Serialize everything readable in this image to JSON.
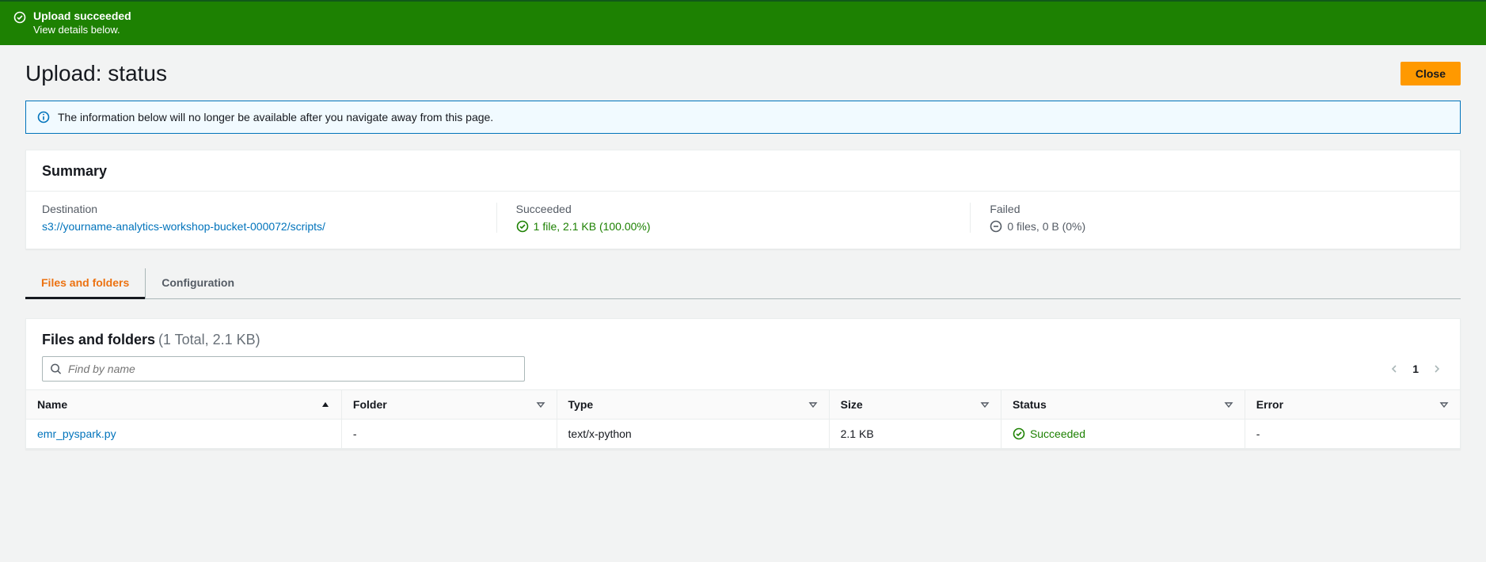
{
  "banner": {
    "title": "Upload succeeded",
    "subtitle": "View details below."
  },
  "page": {
    "title": "Upload: status",
    "close_button": "Close"
  },
  "info": {
    "text": "The information below will no longer be available after you navigate away from this page."
  },
  "summary": {
    "heading": "Summary",
    "destination_label": "Destination",
    "destination_value": "s3://yourname-analytics-workshop-bucket-000072/scripts/",
    "succeeded_label": "Succeeded",
    "succeeded_value": "1 file, 2.1 KB (100.00%)",
    "failed_label": "Failed",
    "failed_value": "0 files, 0 B (0%)"
  },
  "tabs": {
    "files": "Files and folders",
    "config": "Configuration"
  },
  "files": {
    "heading": "Files and folders",
    "meta": "(1 Total, 2.1 KB)",
    "search_placeholder": "Find by name",
    "page_number": "1",
    "columns": {
      "name": "Name",
      "folder": "Folder",
      "type": "Type",
      "size": "Size",
      "status": "Status",
      "error": "Error"
    },
    "rows": [
      {
        "name": "emr_pyspark.py",
        "folder": "-",
        "type": "text/x-python",
        "size": "2.1 KB",
        "status": "Succeeded",
        "error": "-"
      }
    ]
  }
}
